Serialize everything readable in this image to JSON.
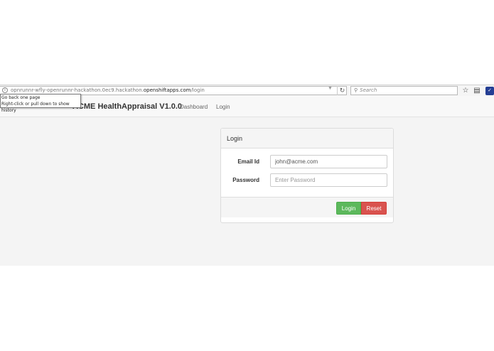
{
  "browser": {
    "url_prefix": "opnrunnr-wfly-openrunnr-hackathon.0ec9.hackathon.",
    "url_domain": "openshiftapps.com",
    "url_path": "/login",
    "search_placeholder": "Search",
    "tooltip_line1": "Go back one page",
    "tooltip_line2": "Right-click or pull down to show history"
  },
  "navbar": {
    "brand": "ACME HealthAppraisal V1.0.0",
    "links": [
      "Dashboard",
      "Login"
    ]
  },
  "login_panel": {
    "title": "Login",
    "email_label": "Email Id",
    "email_value": "john@acme.com",
    "password_label": "Password",
    "password_placeholder": "Enter Password",
    "login_button": "Login",
    "reset_button": "Reset"
  },
  "colors": {
    "login_button": "#5cb85c",
    "reset_button": "#d9534f",
    "page_background": "#f4f4f4"
  },
  "icons": [
    "info-icon",
    "dropdown-arrow-icon",
    "reload-icon",
    "search-icon",
    "bookmark-star-icon",
    "library-icon",
    "pocket-icon"
  ]
}
